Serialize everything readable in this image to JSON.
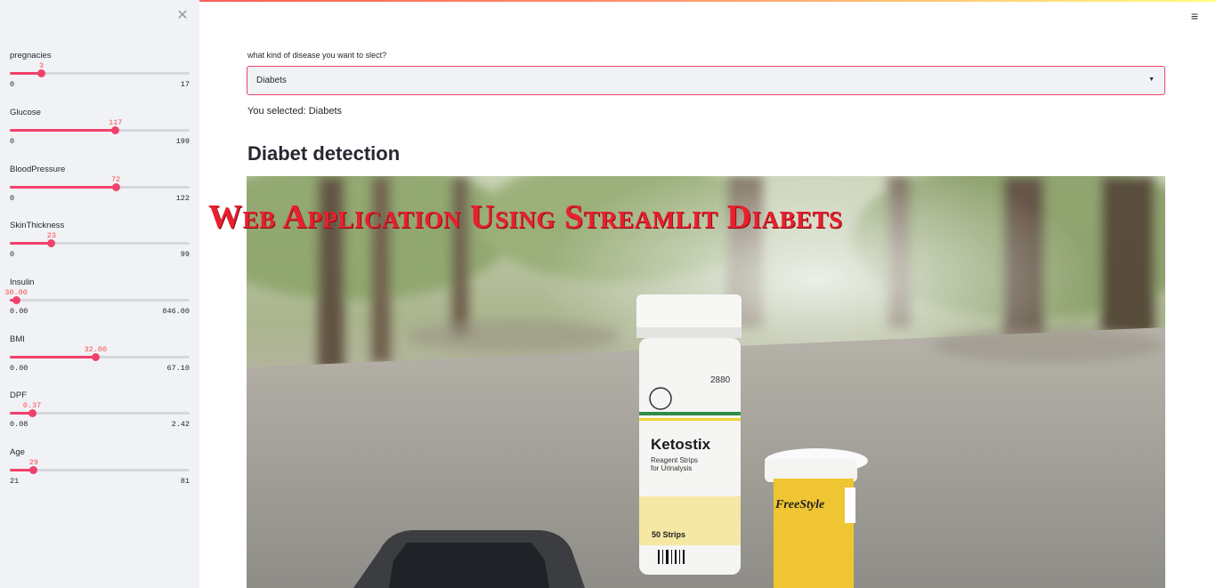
{
  "sidebar": {
    "close_icon": "close-icon",
    "sliders": [
      {
        "label": "pregnacies",
        "value": "3",
        "min": "0",
        "max": "17",
        "fraction": 0.176
      },
      {
        "label": "Glucose",
        "value": "117",
        "min": "0",
        "max": "199",
        "fraction": 0.588
      },
      {
        "label": "BloodPressure",
        "value": "72",
        "min": "0",
        "max": "122",
        "fraction": 0.59
      },
      {
        "label": "SkinThickness",
        "value": "23",
        "min": "0",
        "max": "99",
        "fraction": 0.232
      },
      {
        "label": "Insulin",
        "value": "30.00",
        "min": "0.00",
        "max": "846.00",
        "fraction": 0.035
      },
      {
        "label": "BMI",
        "value": "32.00",
        "min": "0.00",
        "max": "67.10",
        "fraction": 0.477
      },
      {
        "label": "DPF",
        "value": "0.37",
        "min": "0.08",
        "max": "2.42",
        "fraction": 0.124
      },
      {
        "label": "Age",
        "value": "29",
        "min": "21",
        "max": "81",
        "fraction": 0.133
      }
    ]
  },
  "main": {
    "menu_icon": "hamburger-menu-icon",
    "select_label": "what kind of disease you want to slect?",
    "select_value": "Diabets",
    "selected_text": "You selected: Diabets",
    "title": "Diabet detection",
    "banner_text": "Web Application Using Streamlit Diabets"
  },
  "colors": {
    "accent": "#f0416c",
    "sidebar_bg": "#f0f2f6",
    "banner": "#e8202e"
  }
}
